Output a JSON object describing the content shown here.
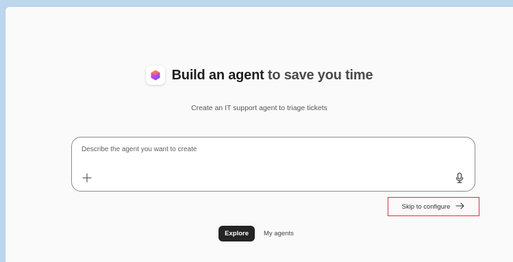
{
  "header": {
    "title_main": "Build an agent",
    "title_accent": " to save you time",
    "subtitle": "Create an IT support agent to triage tickets"
  },
  "prompt": {
    "placeholder": "Describe the agent you want to create",
    "value": ""
  },
  "skip": {
    "label": "Skip to configure"
  },
  "tabs": [
    {
      "label": "Explore",
      "active": true
    },
    {
      "label": "My agents",
      "active": false
    }
  ],
  "icons": {
    "logo": "copilot-logo-icon",
    "add": "plus-icon",
    "voice": "microphone-icon",
    "skip": "arrow-right-icon"
  },
  "colors": {
    "highlight_border": "#d9313a",
    "active_tab_bg": "#242424",
    "window_bg": "#bcd6ee"
  }
}
